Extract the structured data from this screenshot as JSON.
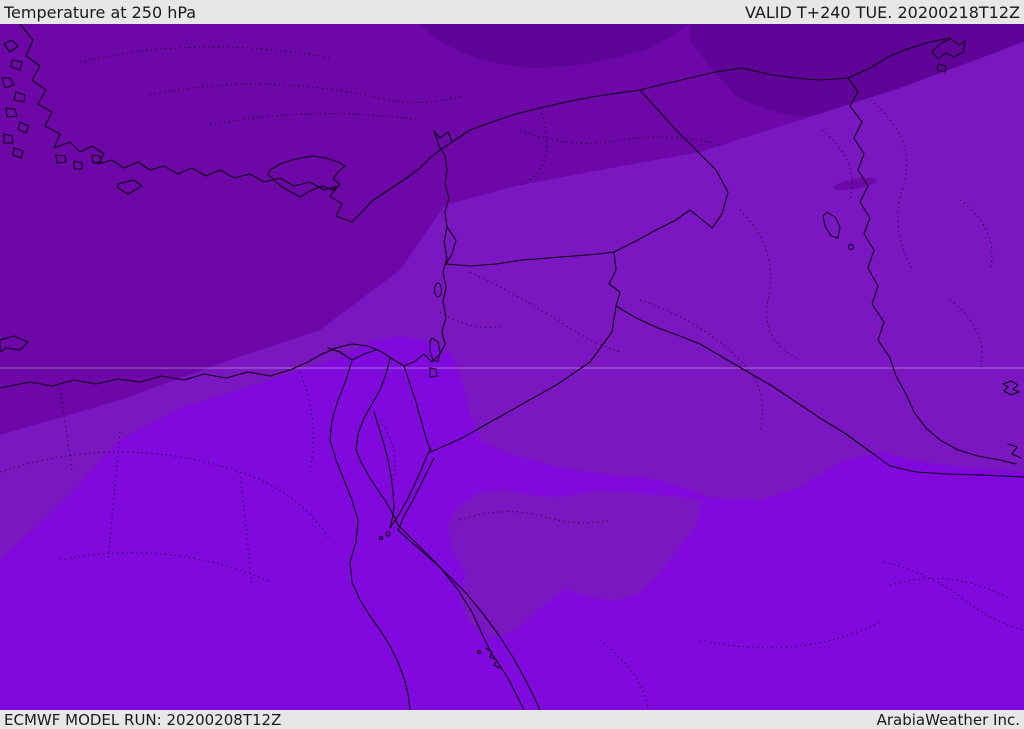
{
  "titlebar": {
    "title": "Temperature at 250 hPa",
    "valid": "VALID T+240 TUE. 20200218T12Z"
  },
  "statusbar": {
    "model_run": "ECMWF MODEL RUN: 20200208T12Z",
    "attribution": "ArabiaWeather Inc."
  },
  "map": {
    "parameter": "Temperature",
    "level": "250 hPa",
    "forecast_hour": "T+240",
    "valid_time": "20200218T12Z",
    "model_run_time": "20200208T12Z",
    "colors": {
      "band_darkest": "#580392",
      "band_dark": "#5e0497",
      "band_main": "#6d07a8",
      "band_light": "#7b17c1",
      "band_bright": "#8009dd",
      "border": "#0d0012",
      "graticule": "#cdb2dc",
      "bar_background": "#e7e7e7",
      "bar_text": "#1a1a1a"
    }
  }
}
